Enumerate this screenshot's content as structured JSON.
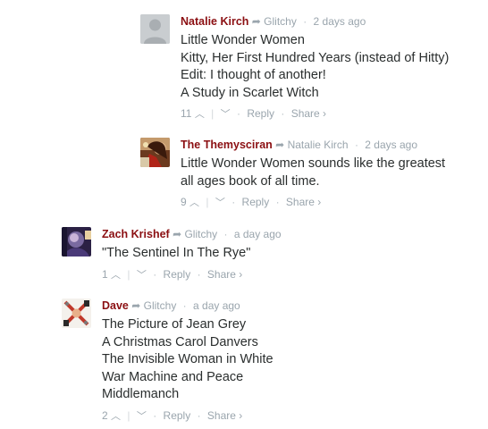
{
  "comments": [
    {
      "author": "Natalie Kirch",
      "reply_to": "Glitchy",
      "time": "2 days ago",
      "lines": [
        "Little Wonder Women",
        "Kitty, Her First Hundred Years (instead of Hitty)",
        "Edit: I thought of another!",
        "A Study in Scarlet Witch"
      ],
      "votes": "11",
      "reply_label": "Reply",
      "share_label": "Share ›",
      "avatar_icon": "default-user-avatar"
    },
    {
      "author": "The Themysciran",
      "reply_to": "Natalie Kirch",
      "time": "2 days ago",
      "lines": [
        "Little Wonder Women sounds like the greatest",
        "all ages book of all time."
      ],
      "votes": "9",
      "reply_label": "Reply",
      "share_label": "Share ›",
      "avatar_icon": "user-photo-avatar"
    },
    {
      "author": "Zach Krishef",
      "reply_to": "Glitchy",
      "time": "a day ago",
      "lines": [
        "\"The Sentinel In The Rye\""
      ],
      "votes": "1",
      "reply_label": "Reply",
      "share_label": "Share ›",
      "avatar_icon": "user-photo-avatar"
    },
    {
      "author": "Dave",
      "reply_to": "Glitchy",
      "time": "a day ago",
      "lines": [
        "The Picture of Jean Grey",
        "A Christmas Carol Danvers",
        "The Invisible Woman in White",
        "War Machine and Peace",
        "Middlemanch"
      ],
      "votes": "2",
      "reply_label": "Reply",
      "share_label": "Share ›",
      "avatar_icon": "user-photo-avatar"
    }
  ],
  "colors": {
    "author": "#8b0f12",
    "meta": "#9aa5ad",
    "text": "#2a2e2e"
  }
}
